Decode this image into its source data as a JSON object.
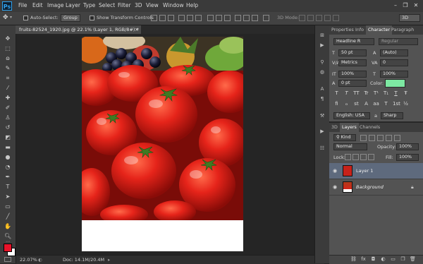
{
  "app": {
    "logo": "Ps"
  },
  "menu": [
    "File",
    "Edit",
    "Image",
    "Layer",
    "Type",
    "Select",
    "Filter",
    "3D",
    "View",
    "Window",
    "Help"
  ],
  "window_controls": {
    "minimize": "–",
    "restore": "❐",
    "close": "✕"
  },
  "options": {
    "auto_select_label": "Auto-Select:",
    "auto_select_value": "Group",
    "show_transform_label": "Show Transform Controls",
    "mode_3d_label": "3D Mode:",
    "workspace_value": "3D"
  },
  "document": {
    "tab_title": "fruits-82524_1920.jpg @ 22.1% (Layer 1, RGB/8#) *",
    "tab_close": "×"
  },
  "status": {
    "zoom": "22.07%",
    "doc_info": "Doc: 14.1M/20.4M"
  },
  "character_panel": {
    "tabs": [
      "Properties",
      "Info",
      "Character",
      "Paragraph"
    ],
    "font_family": "Headline R",
    "font_style": "Regular",
    "font_size": "50 pt",
    "leading": "(Auto)",
    "kerning": "Metrics",
    "tracking": "0",
    "vertical_scale": "100%",
    "horizontal_scale": "100%",
    "baseline_shift": "0 pt",
    "color_label": "Color:",
    "color_value": "#7de8a2",
    "style_buttons": [
      "T",
      "T",
      "TT",
      "Tr",
      "T¹",
      "T₁",
      "T",
      "Ŧ"
    ],
    "opentype_buttons": [
      "fi",
      "ℴ",
      "st",
      "A",
      "aa",
      "T",
      "1st",
      "½"
    ],
    "language": "English: USA",
    "anti_alias_prefix": "a",
    "anti_alias": "Sharp"
  },
  "layers_panel": {
    "tabs": [
      "3D",
      "Layers",
      "Channels"
    ],
    "kind_label": "Kind",
    "blend_mode": "Normal",
    "opacity_label": "Opacity:",
    "opacity_value": "100%",
    "lock_label": "Lock:",
    "fill_label": "Fill:",
    "fill_value": "100%",
    "layers": [
      {
        "name": "Layer 1",
        "selected": true
      },
      {
        "name": "Background",
        "selected": false,
        "locked": true
      }
    ]
  },
  "colors": {
    "foreground": "#e8132a",
    "background": "#ffffff",
    "selection": "#5e6a7d"
  }
}
